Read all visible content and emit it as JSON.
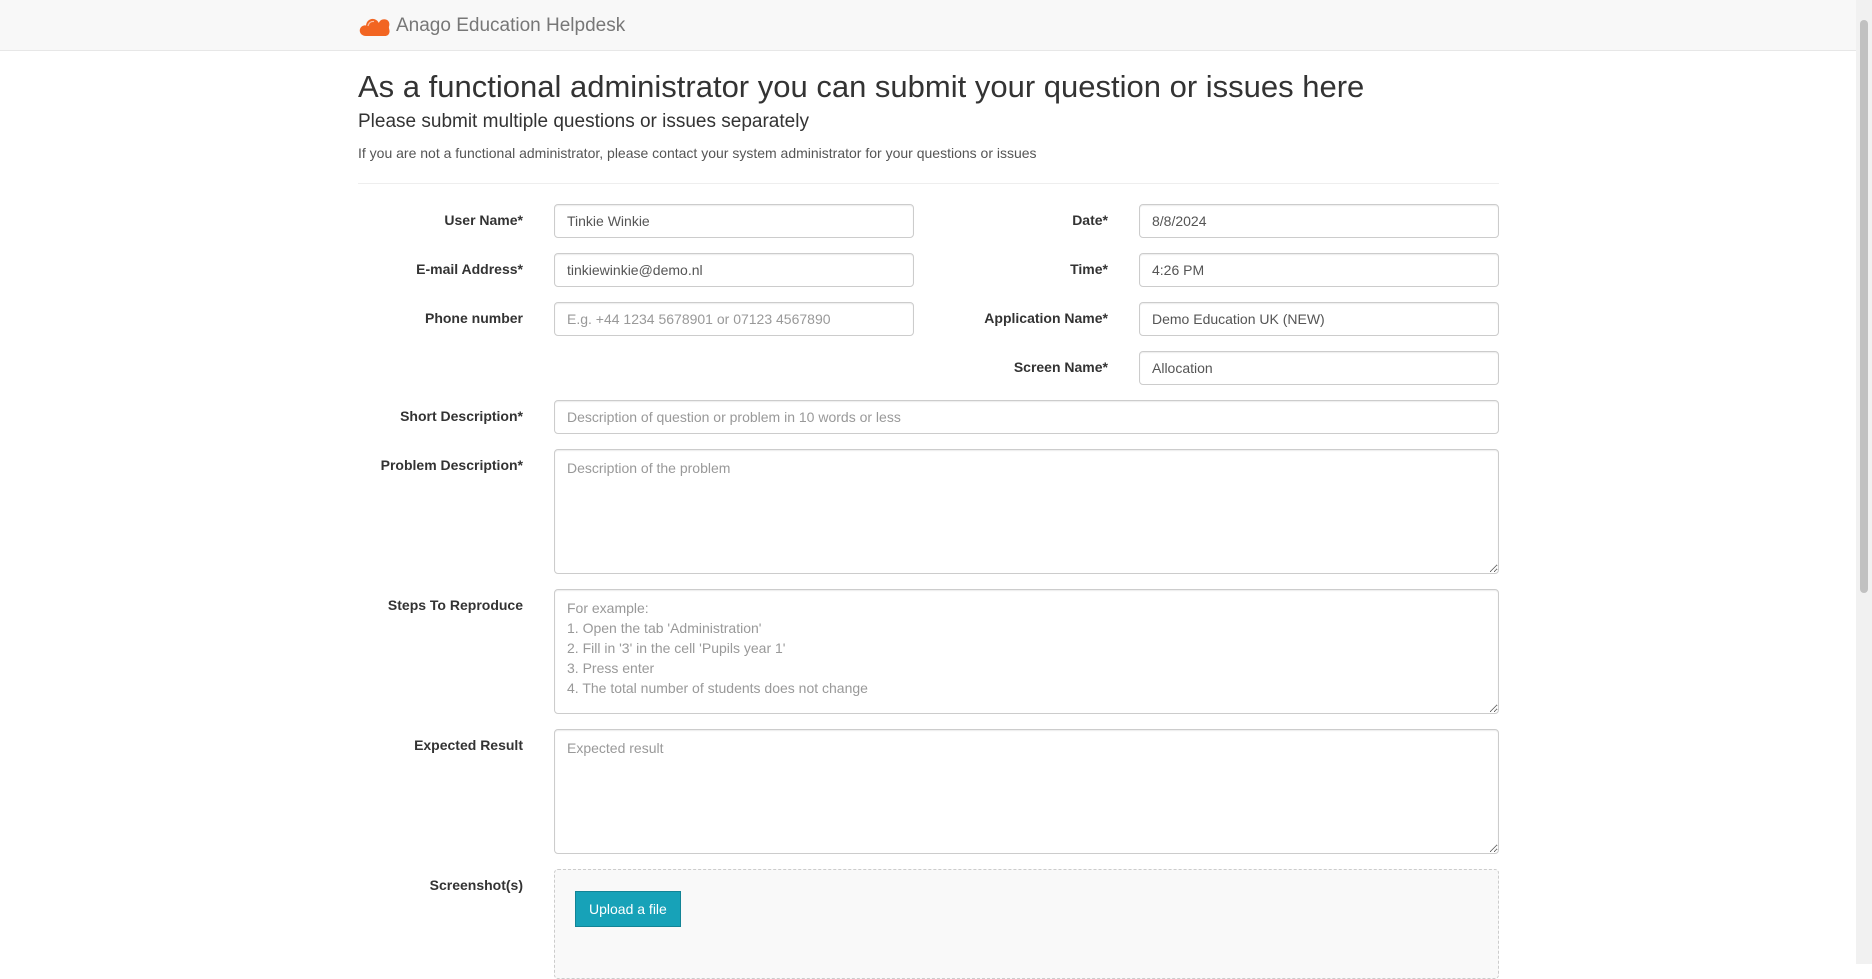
{
  "header": {
    "brand_name": "Anago Education Helpdesk",
    "brand_color": "#f26522"
  },
  "intro": {
    "title": "As a functional administrator you can submit your question or issues here",
    "subtitle": "Please submit multiple questions or issues separately",
    "note": "If you are not a functional administrator, please contact your system administrator for your questions or issues"
  },
  "form": {
    "required_marker": "*",
    "user_name": {
      "label": "User Name",
      "value": "Tinkie Winkie"
    },
    "email": {
      "label": "E-mail Address",
      "value": "tinkiewinkie@demo.nl"
    },
    "phone": {
      "label": "Phone number",
      "value": "",
      "placeholder": "E.g. +44 1234 5678901 or 07123 4567890"
    },
    "date": {
      "label": "Date",
      "value": "8/8/2024"
    },
    "time": {
      "label": "Time",
      "value": "4:26 PM"
    },
    "application_name": {
      "label": "Application Name",
      "value": "Demo Education UK (NEW)"
    },
    "screen_name": {
      "label": "Screen Name",
      "value": "Allocation"
    },
    "short_description": {
      "label": "Short Description",
      "value": "",
      "placeholder": "Description of question or problem in 10 words or less"
    },
    "problem_description": {
      "label": "Problem Description",
      "value": "",
      "placeholder": "Description of the problem"
    },
    "steps": {
      "label": "Steps To Reproduce",
      "value": "",
      "placeholder": "For example:\n1. Open the tab 'Administration'\n2. Fill in '3' in the cell 'Pupils year 1'\n3. Press enter\n4. The total number of students does not change"
    },
    "expected_result": {
      "label": "Expected Result",
      "value": "",
      "placeholder": "Expected result"
    },
    "screenshots": {
      "label": "Screenshot(s)",
      "upload_label": "Upload a file"
    }
  }
}
